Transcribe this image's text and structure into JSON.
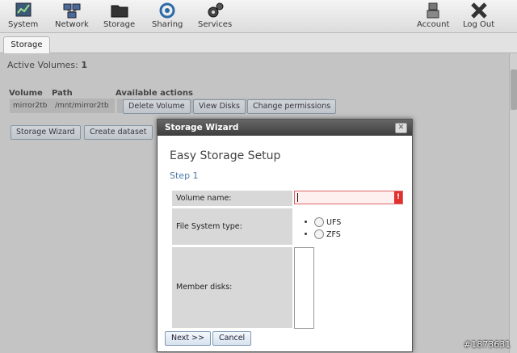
{
  "toolbar": {
    "items": [
      {
        "label": "System",
        "icon": "system-icon"
      },
      {
        "label": "Network",
        "icon": "network-icon"
      },
      {
        "label": "Storage",
        "icon": "storage-icon"
      },
      {
        "label": "Sharing",
        "icon": "sharing-icon"
      },
      {
        "label": "Services",
        "icon": "services-icon"
      },
      {
        "label": "Account",
        "icon": "account-icon"
      },
      {
        "label": "Log Out",
        "icon": "logout-icon"
      }
    ]
  },
  "tabs": [
    {
      "label": "Storage"
    }
  ],
  "storage": {
    "active_volumes_label": "Active Volumes:",
    "active_volumes_count": "1",
    "columns": [
      "Volume",
      "Path",
      "Available actions"
    ],
    "volumes": [
      {
        "volume": "mirror2tb",
        "path": "/mnt/mirror2tb",
        "actions": [
          "Delete Volume",
          "View Disks",
          "Change permissions"
        ]
      }
    ],
    "buttons": {
      "wizard": "Storage Wizard",
      "create_dataset": "Create dataset"
    }
  },
  "dialog": {
    "title": "Storage Wizard",
    "close_glyph": "✕",
    "heading": "Easy Storage Setup",
    "step": "Step 1",
    "fields": {
      "volume_name_label": "Volume name:",
      "volume_name_value": "",
      "fs_type_label": "File System type:",
      "fs_options": [
        "UFS",
        "ZFS"
      ],
      "member_disks_label": "Member disks:"
    },
    "buttons": {
      "next": "Next >>",
      "cancel": "Cancel"
    },
    "warning_glyph": "!"
  },
  "watermark": "#1873631",
  "colors": {
    "accent": "#4a7aa8",
    "error": "#e03030",
    "titlebar": "#4a4a4a"
  }
}
